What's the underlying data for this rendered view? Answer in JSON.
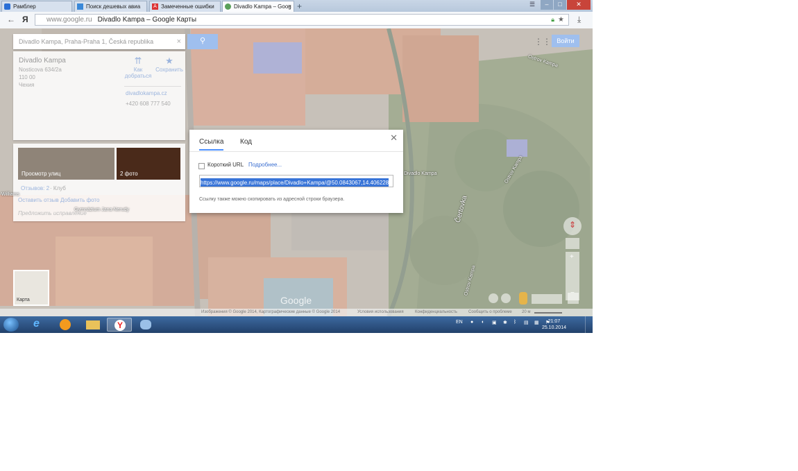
{
  "browser": {
    "tabs": [
      {
        "label": "Рамблер"
      },
      {
        "label": "Поиск дешевых авиа"
      },
      {
        "label": "Замеченные ошибки"
      },
      {
        "label": "Divadlo Kampa – Goog"
      }
    ],
    "new_tab": "+",
    "address": {
      "host": "www.google.ru",
      "title": "Divadlo Kampa – Google Карты"
    }
  },
  "map": {
    "search": {
      "value": "Divadlo Kampa, Praha-Praha 1, Česká republika",
      "button": "search-icon"
    },
    "signin_label": "Войти",
    "place": {
      "name": "Divadlo Kampa",
      "address": "Nosticova 634/2a",
      "postcode": "110 00",
      "country": "Чехия",
      "directions_label": "Как добраться",
      "save_label": "Сохранить",
      "website": "divadlokampa.cz",
      "phone": "+420 608 777 540"
    },
    "photos": {
      "streetview_label": "Просмотр улиц",
      "photos_label": "2 фото",
      "reviews": "Отзывов: 2",
      "category": "· Клуб",
      "leave_review": "Оставить отзыв",
      "add_photo": "Добавить фото",
      "suggest_edit": "Предложить исправление"
    },
    "labels": {
      "divadlo": "Divadlo Kampa",
      "gymnazium": "Gymnázium Jana Nerudy",
      "ostrov_kampa_1": "Ostrov Kampa",
      "ostrov_kampa_2": "Ostrov Kampa",
      "ostrov_kampa_3": "Ostrov Kampa",
      "certovka": "Čertovka",
      "williams": "Williams"
    },
    "minimap_label": "Карта",
    "google_logo": "Google",
    "footer": {
      "imagery": "Изображения © Google 2014, Картографические данные © Google 2014",
      "terms": "Условия использования",
      "privacy": "Конфиденциальность",
      "report": "Сообщить о проблеме",
      "scale": "20 м"
    }
  },
  "share_dialog": {
    "tab_link": "Ссылка",
    "tab_code": "Код",
    "short_url_label": "Короткий URL",
    "more_link": "Подробнее...",
    "url": "https://www.google.ru/maps/place/Divadlo+Kampa/@50.0843067,14.406228",
    "hint": "Ссылку также можно скопировать из адресной строки браузера."
  },
  "taskbar": {
    "lang": "EN",
    "time": "21:07",
    "date": "25.10.2014"
  }
}
